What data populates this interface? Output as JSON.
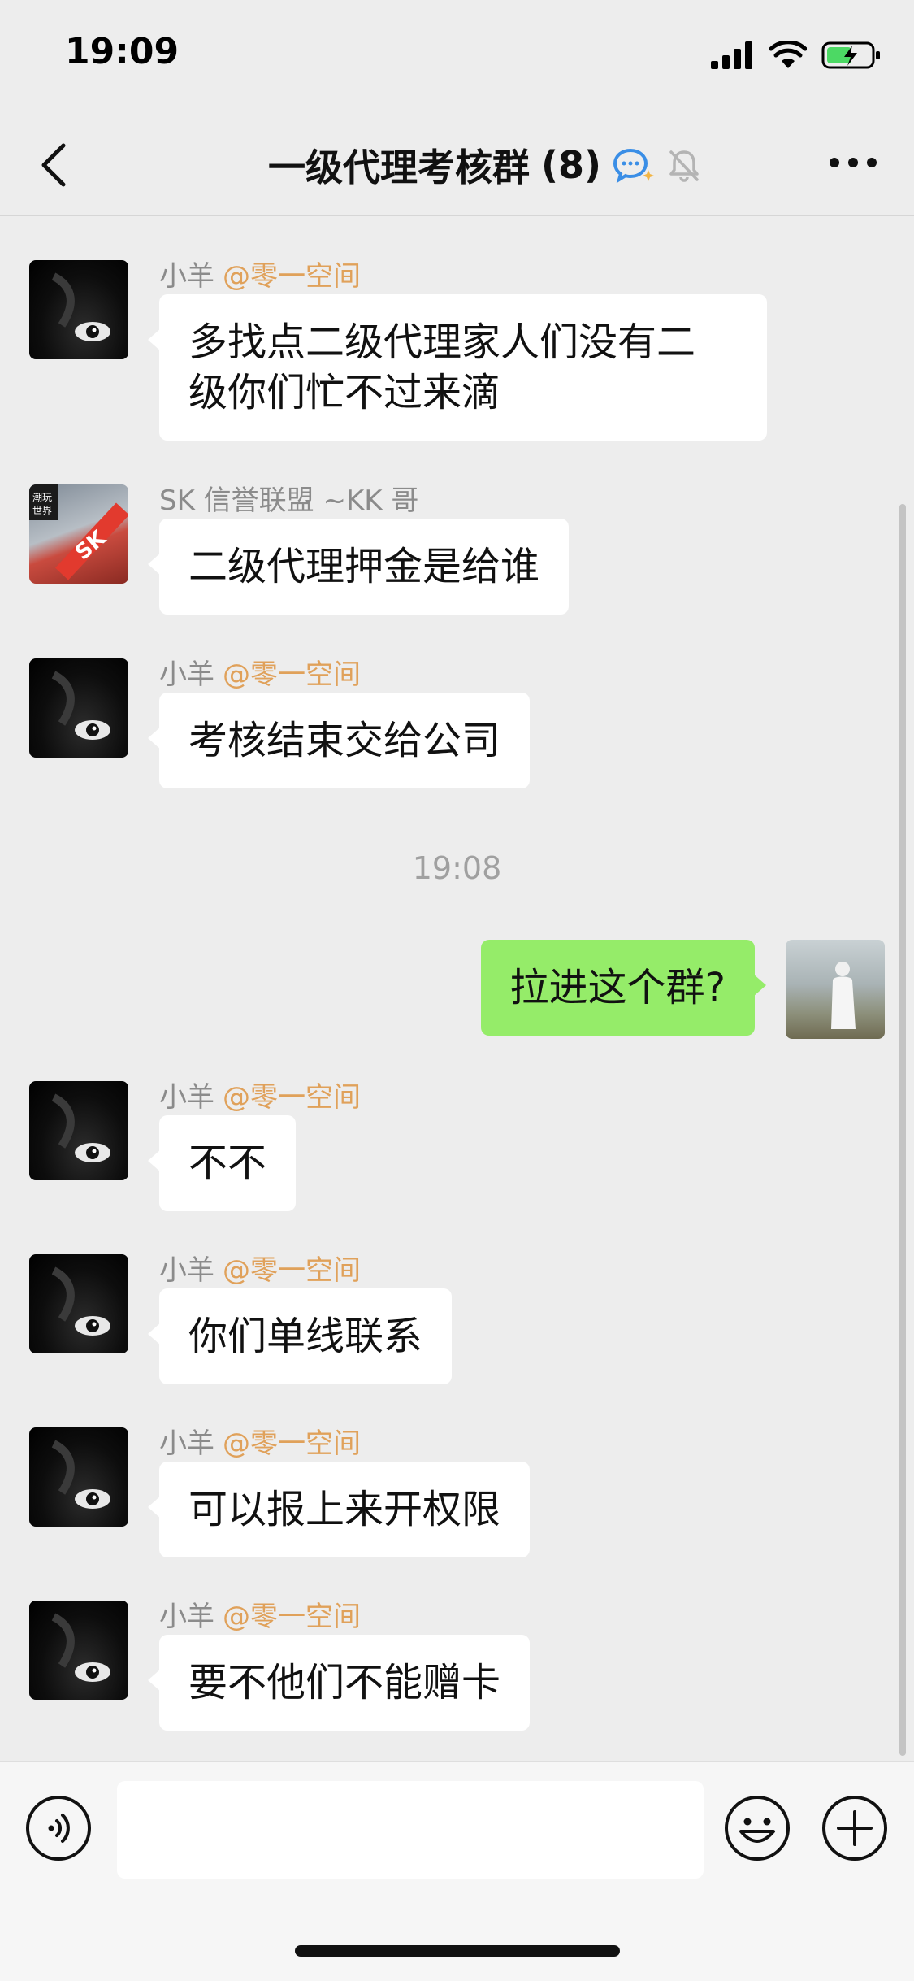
{
  "status_bar": {
    "time": "19:09"
  },
  "header": {
    "title": "一级代理考核群",
    "member_count": "(8)"
  },
  "messages": [
    {
      "sender": "小羊",
      "org": "@零一空间",
      "text_lines": [
        "多找点二级代理家人们没有二",
        "级你们忙不过来滴"
      ]
    },
    {
      "sender": "SK 信誉联盟 ~KK 哥",
      "org": "",
      "text_lines": [
        "二级代理押金是给谁"
      ],
      "avatar_text": "潮玩世界"
    },
    {
      "sender": "小羊",
      "org": "@零一空间",
      "text_lines": [
        "考核结束交给公司"
      ]
    },
    {
      "timestamp": "19:08"
    },
    {
      "self": true,
      "text_lines": [
        "拉进这个群?"
      ]
    },
    {
      "sender": "小羊",
      "org": "@零一空间",
      "text_lines": [
        "不不"
      ]
    },
    {
      "sender": "小羊",
      "org": "@零一空间",
      "text_lines": [
        "你们单线联系"
      ]
    },
    {
      "sender": "小羊",
      "org": "@零一空间",
      "text_lines": [
        "可以报上来开权限"
      ]
    },
    {
      "sender": "小羊",
      "org": "@零一空间",
      "text_lines": [
        "要不他们不能赠卡"
      ]
    }
  ],
  "input": {
    "value": ""
  },
  "colors": {
    "background": "#ededed",
    "incoming_bubble": "#ffffff",
    "outgoing_bubble": "#95ec69",
    "org_tag": "#e0a15a"
  }
}
